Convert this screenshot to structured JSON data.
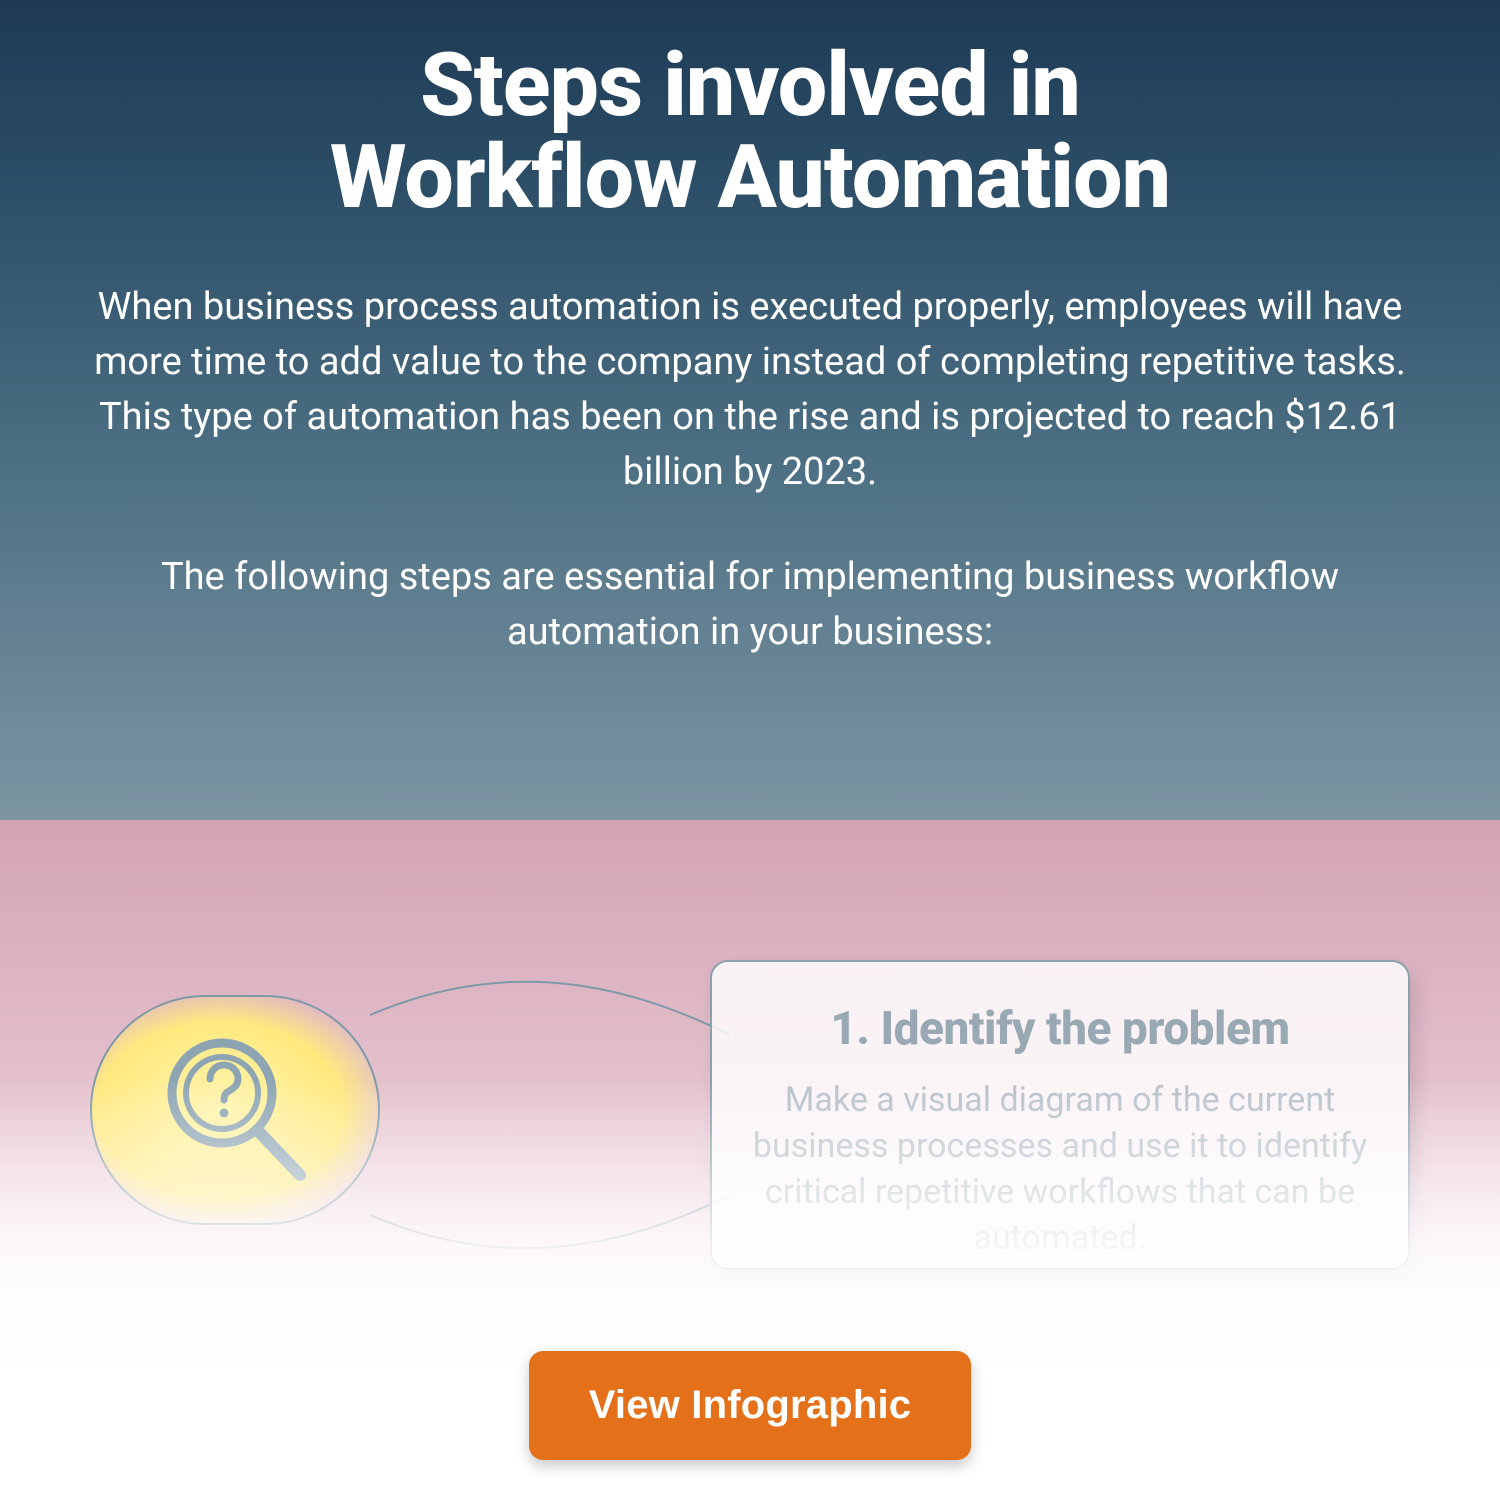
{
  "hero": {
    "title_line1": "Steps involved in",
    "title_line2": "Workflow Automation",
    "paragraph1": "When business process automation is executed properly, employees will have more time to add value to the company instead of completing repetitive tasks. This type of automation has been on the rise and is projected to reach $12.61 billion by 2023.",
    "paragraph2": "The following steps are essential for implementing business workflow automation in your business:"
  },
  "step1": {
    "heading": "1. Identify the problem",
    "body": "Make a visual diagram of the current business processes and use it to identify critical repetitive workflows that can be automated.",
    "icon": "magnifier-question-icon",
    "accent_color": "#ffe97e"
  },
  "cta": {
    "label": "View Infographic"
  },
  "colors": {
    "hero_top": "#1e3a55",
    "hero_bottom": "#7d95a3",
    "body_pink": "#d3a3b4",
    "button": "#e47019"
  }
}
